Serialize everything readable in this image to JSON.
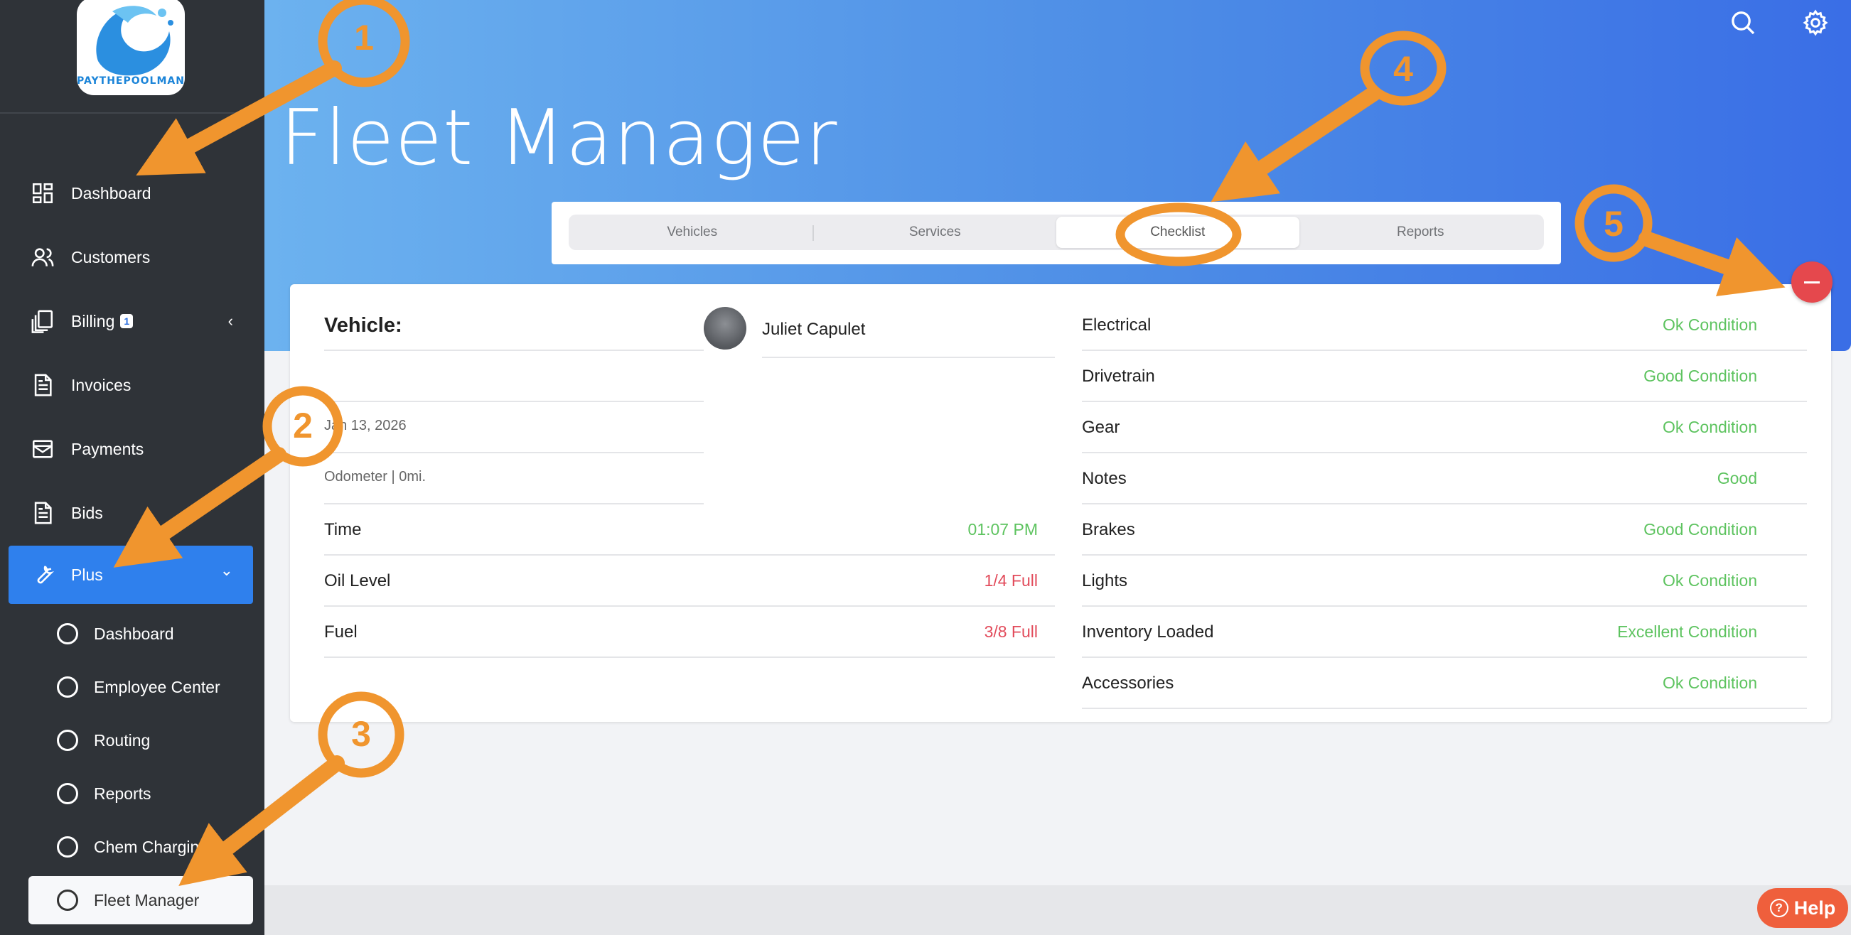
{
  "sidebar": {
    "logo_text": "PAYTHEPOOLMAN",
    "items": [
      {
        "label": "Dashboard",
        "icon": "dashboard-icon"
      },
      {
        "label": "Customers",
        "icon": "users-icon"
      },
      {
        "label": "Billing",
        "icon": "billing-icon",
        "badge": "1"
      },
      {
        "label": "Invoices",
        "icon": "document-icon"
      },
      {
        "label": "Payments",
        "icon": "payments-icon"
      },
      {
        "label": "Bids",
        "icon": "document-icon"
      },
      {
        "label": "Plus",
        "icon": "wrench-icon"
      }
    ],
    "sub_items": [
      "Dashboard",
      "Employee Center",
      "Routing",
      "Reports",
      "Chem Charging",
      "Fleet Manager"
    ]
  },
  "header": {
    "title": "Fleet Manager",
    "icons": [
      "search-icon",
      "gear-icon"
    ]
  },
  "tabs": [
    "Vehicles",
    "Services",
    "Checklist",
    "Reports"
  ],
  "active_tab": "Checklist",
  "record": {
    "vehicle_label": "Vehicle:",
    "employee": "Juliet Capulet",
    "date": "Jan 13, 2026",
    "odometer": "Odometer | 0mi.",
    "details": [
      {
        "label": "Time",
        "value": "01:07 PM",
        "status": "green"
      },
      {
        "label": "Oil Level",
        "value": "1/4 Full",
        "status": "red"
      },
      {
        "label": "Fuel",
        "value": "3/8 Full",
        "status": "red"
      }
    ],
    "checklist": [
      {
        "label": "Electrical",
        "value": "Ok Condition"
      },
      {
        "label": "Drivetrain",
        "value": "Good Condition"
      },
      {
        "label": "Gear",
        "value": "Ok Condition"
      },
      {
        "label": "Notes",
        "value": "Good"
      },
      {
        "label": "Brakes",
        "value": "Good Condition"
      },
      {
        "label": "Lights",
        "value": "Ok Condition"
      },
      {
        "label": "Inventory Loaded",
        "value": "Excellent Condition"
      },
      {
        "label": "Accessories",
        "value": "Ok Condition"
      }
    ]
  },
  "help_label": "Help",
  "annotations": [
    "1",
    "2",
    "3",
    "4",
    "5"
  ],
  "colors": {
    "sidebar_bg": "#2f3338",
    "active_nav": "#2f80ed",
    "ok_green": "#5dc35f",
    "warn_red": "#e24b5b",
    "annotation_orange": "#f0952e",
    "close_red": "#e5484d"
  }
}
